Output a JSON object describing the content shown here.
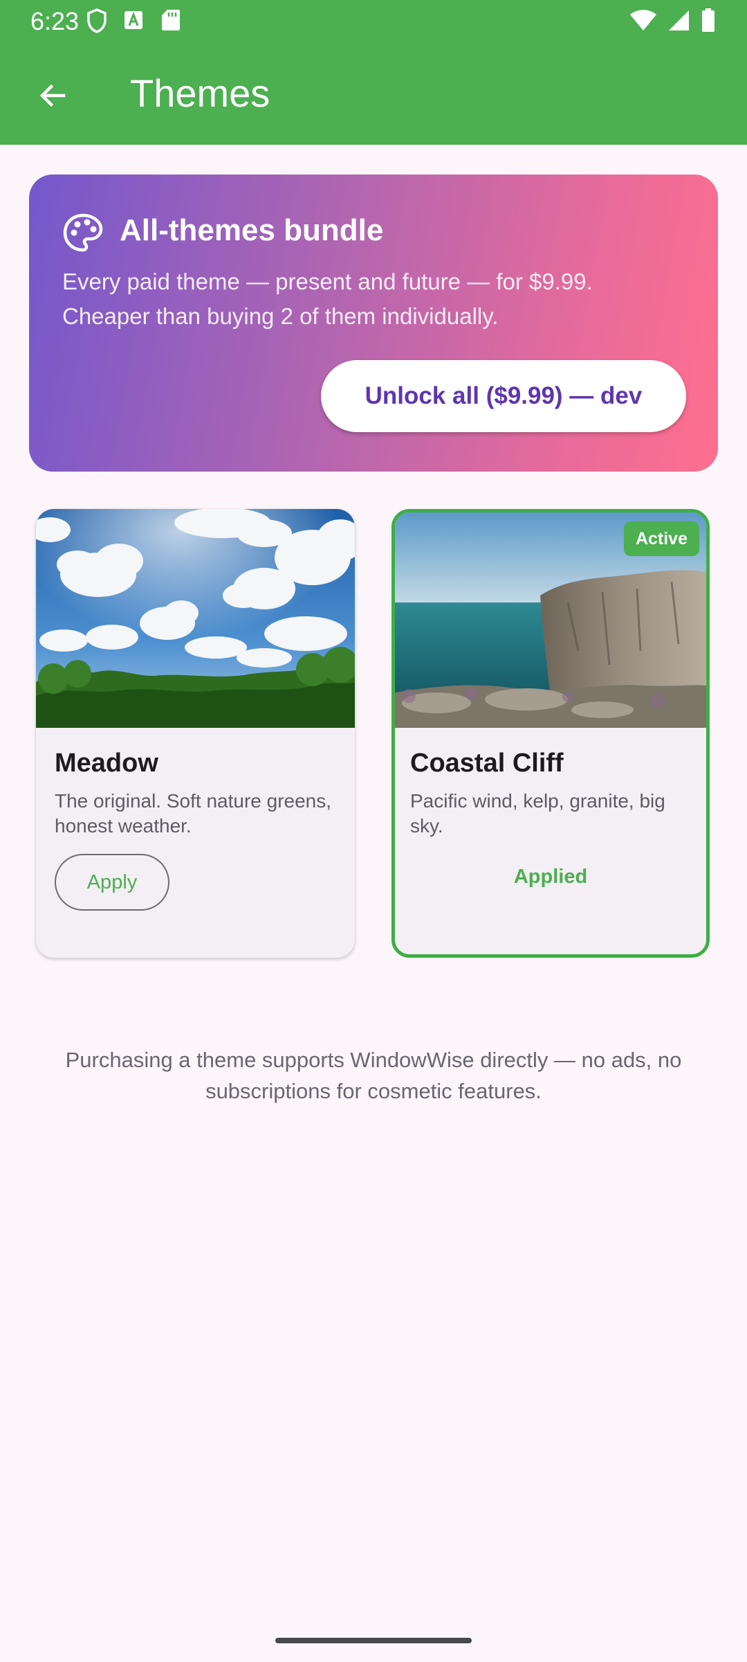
{
  "status_bar": {
    "time": "6:23",
    "left_icons": [
      "shield-icon",
      "font-download-icon",
      "sd-card-icon"
    ],
    "right_icons": [
      "wifi-icon",
      "cellular-signal-icon",
      "battery-icon"
    ]
  },
  "app_bar": {
    "title": "Themes",
    "back_icon": "arrow-back-icon",
    "color": "#4caf50"
  },
  "bundle": {
    "icon": "palette-icon",
    "title": "All-themes bundle",
    "description": "Every paid theme — present and future — for $9.99. Cheaper than buying 2 of them individually.",
    "button_label": "Unlock all ($9.99) — dev",
    "gradient": [
      "#7458cc",
      "#ff6f8e"
    ]
  },
  "themes": [
    {
      "name": "Meadow",
      "description": "The original. Soft nature greens, honest weather.",
      "action_label": "Apply",
      "active": false,
      "image": "meadow-sky-photo"
    },
    {
      "name": "Coastal Cliff",
      "description": "Pacific wind, kelp, granite, big sky.",
      "status_label": "Applied",
      "badge": "Active",
      "active": true,
      "image": "coastal-cliff-photo"
    }
  ],
  "footer_note": "Purchasing a theme supports WindowWise directly — no ads, no subscriptions for cosmetic features.",
  "colors": {
    "accent": "#4caf50",
    "background": "#fcf6fb",
    "bundle_button_text": "#5e35b1"
  }
}
